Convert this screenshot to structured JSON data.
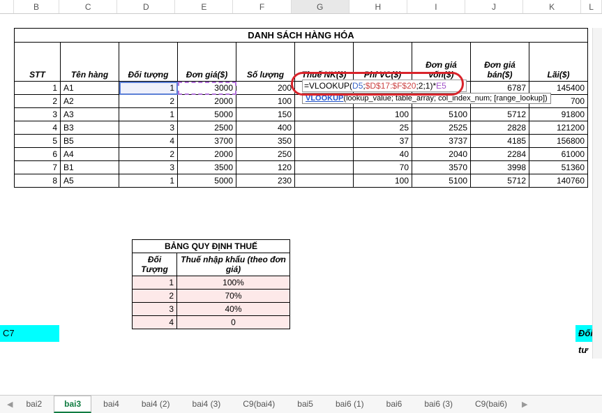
{
  "columns": [
    "B",
    "C",
    "D",
    "E",
    "F",
    "G",
    "H",
    "I",
    "J",
    "K",
    "L"
  ],
  "activeCol": "G",
  "sheet": {
    "title": "DANH SÁCH HÀNG HÓA",
    "headers": {
      "stt": "STT",
      "ten": "Tên hàng",
      "doituong": "Đối tượng",
      "dongia": "Đơn giá($)",
      "soluong": "Số lượng",
      "thue": "Thuế NK($)",
      "phi": "Phí VC($)",
      "giavon": "Đơn giá vốn($)",
      "giaban": "Đơn giá bán($)",
      "lai": "Lãi($)"
    },
    "rows": [
      {
        "stt": "1",
        "ten": "A1",
        "dt": "1",
        "dg": "3000",
        "sl": "200",
        "thue": "",
        "phi": "",
        "gv": "",
        "gb": "6787",
        "lai": "145400"
      },
      {
        "stt": "2",
        "ten": "A2",
        "dt": "2",
        "dg": "2000",
        "sl": "100",
        "thue": "",
        "phi": "",
        "gv": "",
        "gb": "",
        "lai": "700"
      },
      {
        "stt": "3",
        "ten": "A3",
        "dt": "1",
        "dg": "5000",
        "sl": "150",
        "thue": "",
        "phi": "100",
        "gv": "5100",
        "gb": "5712",
        "lai": "91800"
      },
      {
        "stt": "4",
        "ten": "B3",
        "dt": "3",
        "dg": "2500",
        "sl": "400",
        "thue": "",
        "phi": "25",
        "gv": "2525",
        "gb": "2828",
        "lai": "121200"
      },
      {
        "stt": "5",
        "ten": "B5",
        "dt": "4",
        "dg": "3700",
        "sl": "350",
        "thue": "",
        "phi": "37",
        "gv": "3737",
        "gb": "4185",
        "lai": "156800"
      },
      {
        "stt": "6",
        "ten": "A4",
        "dt": "2",
        "dg": "2000",
        "sl": "250",
        "thue": "",
        "phi": "40",
        "gv": "2040",
        "gb": "2284",
        "lai": "61000"
      },
      {
        "stt": "7",
        "ten": "B1",
        "dt": "3",
        "dg": "3500",
        "sl": "120",
        "thue": "",
        "phi": "70",
        "gv": "3570",
        "gb": "3998",
        "lai": "51360"
      },
      {
        "stt": "8",
        "ten": "A5",
        "dt": "1",
        "dg": "5000",
        "sl": "230",
        "thue": "",
        "phi": "100",
        "gv": "5100",
        "gb": "5712",
        "lai": "140760"
      }
    ]
  },
  "formula": {
    "prefix": "=VLOOKUP(",
    "ref1": "D5",
    "sep1": ";",
    "ref2": "$D$17:$F$20",
    "sep2": ";2;1)*",
    "ref3": "E5"
  },
  "hint": {
    "fn": "VLOOKUP",
    "args": "(lookup_value; table_array; col_index_num; [range_lookup])"
  },
  "tax": {
    "title": "BẢNG QUY ĐỊNH THUẾ",
    "h1": "Đối Tượng",
    "h2": "Thuế nhập khẩu (theo đơn giá)",
    "rows": [
      {
        "k": "1",
        "v": "100%"
      },
      {
        "k": "2",
        "v": "70%"
      },
      {
        "k": "3",
        "v": "40%"
      },
      {
        "k": "4",
        "v": "0"
      }
    ]
  },
  "floats": {
    "left": "C7",
    "right": "Đối tư"
  },
  "tabs": [
    "bai2",
    "bai3",
    "bai4",
    "bai4 (2)",
    "bai4 (3)",
    "C9(bai4)",
    "bai5",
    "bai6 (1)",
    "bai6",
    "bai6 (3)",
    "C9(bai6)"
  ],
  "activeTab": "bai3",
  "chart_data": {
    "type": "table",
    "title": "DANH SÁCH HÀNG HÓA",
    "columns": [
      "STT",
      "Tên hàng",
      "Đối tượng",
      "Đơn giá($)",
      "Số lượng",
      "Thuế NK($)",
      "Phí VC($)",
      "Đơn giá vốn($)",
      "Đơn giá bán($)",
      "Lãi($)"
    ],
    "rows": [
      [
        1,
        "A1",
        1,
        3000,
        200,
        null,
        null,
        null,
        6787,
        145400
      ],
      [
        2,
        "A2",
        2,
        2000,
        100,
        null,
        null,
        null,
        null,
        700
      ],
      [
        3,
        "A3",
        1,
        5000,
        150,
        null,
        100,
        5100,
        5712,
        91800
      ],
      [
        4,
        "B3",
        3,
        2500,
        400,
        null,
        25,
        2525,
        2828,
        121200
      ],
      [
        5,
        "B5",
        4,
        3700,
        350,
        null,
        37,
        3737,
        4185,
        156800
      ],
      [
        6,
        "A4",
        2,
        2000,
        250,
        null,
        40,
        2040,
        2284,
        61000
      ],
      [
        7,
        "B1",
        3,
        3500,
        120,
        null,
        70,
        3570,
        3998,
        51360
      ],
      [
        8,
        "A5",
        1,
        5000,
        230,
        null,
        100,
        5100,
        5712,
        140760
      ]
    ],
    "lookup_table": {
      "title": "BẢNG QUY ĐỊNH THUẾ",
      "columns": [
        "Đối Tượng",
        "Thuế nhập khẩu (theo đơn giá)"
      ],
      "rows": [
        [
          1,
          "100%"
        ],
        [
          2,
          "70%"
        ],
        [
          3,
          "40%"
        ],
        [
          4,
          0
        ]
      ]
    },
    "active_formula": "=VLOOKUP(D5;$D$17:$F$20;2;1)*E5"
  }
}
